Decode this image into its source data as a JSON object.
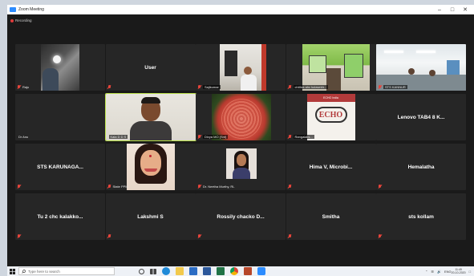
{
  "window": {
    "title": "Zoom Meeting",
    "minimize": "–",
    "maximize": "□",
    "close": "✕"
  },
  "recording": {
    "label": "Recording"
  },
  "participants": {
    "raju": "Raju",
    "user": "User",
    "sajikumar": "Sajikumar",
    "chithra": "chithra ahc kulasekh...",
    "sts_kannur": "STS KANNUR",
    "dr_anu": "Dr Anu",
    "kala": "Kala D D S",
    "divya": "Divya MO (Snt)",
    "rangalakshmi": "Rangalaks..."
  },
  "screen_share_text": {
    "echo": "ECHO",
    "echo_small": "ECHO India"
  },
  "names": {
    "lenovo": "Lenovo TAB4 8 K...",
    "sts_karunaga": "STS KARUNAGA...",
    "state_ppm": "State PPM",
    "neetha": "Dr. Neetha Murthy, RL",
    "hima": "Hima V, Microbi...",
    "hemalatha": "Hemalatha",
    "tu2": "Tu 2 chc kalakko...",
    "lakshmi": "Lakshmi S",
    "rossily": "Rossily chacko D...",
    "smitha": "Smitha",
    "sts_kollam": "sts kollam"
  },
  "taskbar": {
    "search_placeholder": "Type here to search",
    "lang": "ENG",
    "time": "11:49",
    "date": "20-10-2020"
  },
  "colors": {
    "accent_active_speaker": "#b9df4a",
    "muted_mic": "#e8453c",
    "tile_bg": "#262626"
  }
}
